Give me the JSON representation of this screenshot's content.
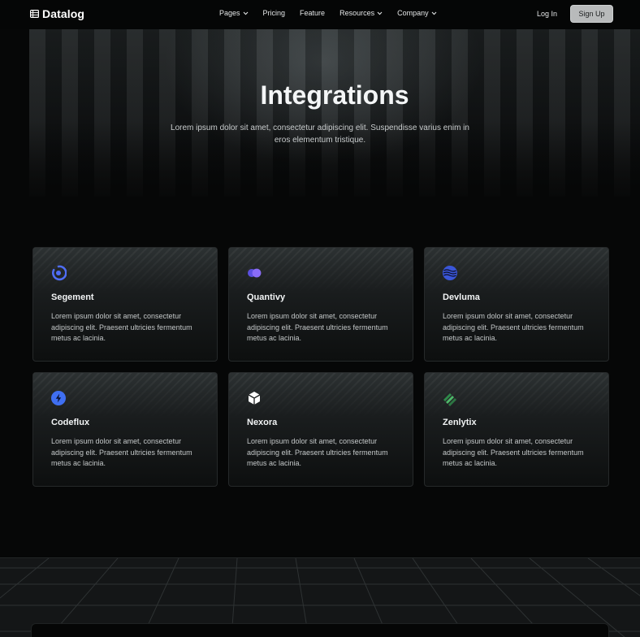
{
  "nav": {
    "brand": "Datalog",
    "menu": [
      {
        "label": "Pages",
        "dropdown": true
      },
      {
        "label": "Pricing",
        "dropdown": false
      },
      {
        "label": "Feature",
        "dropdown": false
      },
      {
        "label": "Resources",
        "dropdown": true
      },
      {
        "label": "Company",
        "dropdown": true
      }
    ],
    "login_label": "Log In",
    "signup_label": "Sign Up"
  },
  "hero": {
    "title": "Integrations",
    "subtitle": "Lorem ipsum dolor sit amet, consectetur adipiscing elit. Suspendisse varius enim in eros elementum tristique."
  },
  "integrations": [
    {
      "name": "Segement",
      "icon": "segement-logo-icon",
      "color": "#4f6df5",
      "description": "Lorem ipsum dolor sit amet, consectetur adipiscing elit. Praesent ultricies fermentum metus ac lacinia."
    },
    {
      "name": "Quantivy",
      "icon": "quantivy-logo-icon",
      "color": "#7b5cf5",
      "description": "Lorem ipsum dolor sit amet, consectetur adipiscing elit. Praesent ultricies fermentum metus ac lacinia."
    },
    {
      "name": "Devluma",
      "icon": "devluma-logo-icon",
      "color": "#4a63e6",
      "description": "Lorem ipsum dolor sit amet, consectetur adipiscing elit. Praesent ultricies fermentum metus ac lacinia."
    },
    {
      "name": "Codeflux",
      "icon": "codeflux-logo-icon",
      "color": "#3f6ff2",
      "description": "Lorem ipsum dolor sit amet, consectetur adipiscing elit. Praesent ultricies fermentum metus ac lacinia."
    },
    {
      "name": "Nexora",
      "icon": "nexora-cube-icon",
      "color": "#ffffff",
      "description": "Lorem ipsum dolor sit amet, consectetur adipiscing elit. Praesent ultricies fermentum metus ac lacinia."
    },
    {
      "name": "Zenlytix",
      "icon": "zenlytix-leaf-icon",
      "color": "#3fa35b",
      "description": "Lorem ipsum dolor sit amet, consectetur adipiscing elit. Praesent ultricies fermentum metus ac lacinia."
    }
  ]
}
